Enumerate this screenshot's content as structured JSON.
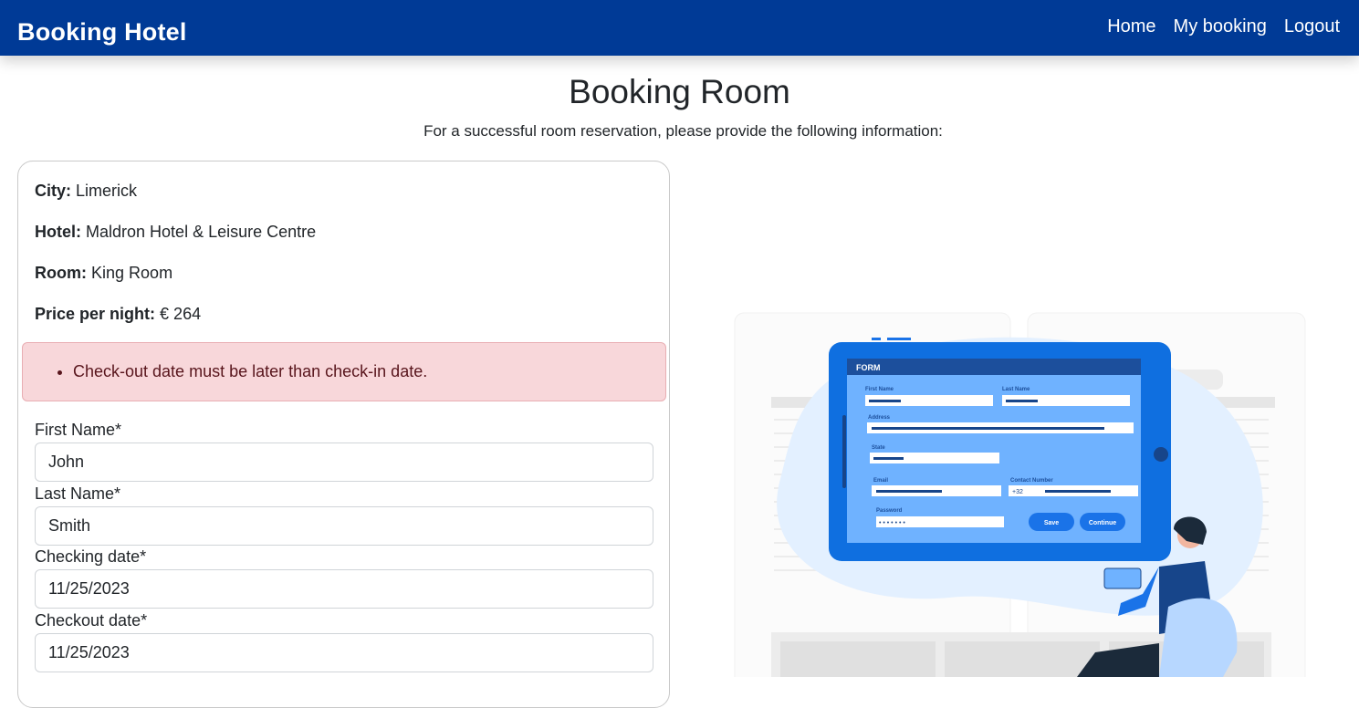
{
  "navbar": {
    "brand": "Booking Hotel",
    "links": [
      "Home",
      "My booking",
      "Logout"
    ],
    "color": "#003a96"
  },
  "page": {
    "title": "Booking Room",
    "subtitle": "For a successful room reservation, please provide the following information:"
  },
  "booking": {
    "city_label": "City:",
    "city": "Limerick",
    "hotel_label": "Hotel:",
    "hotel": "Maldron Hotel & Leisure Centre",
    "room_label": "Room:",
    "room": "King Room",
    "price_label": "Price per night:",
    "price": "€ 264"
  },
  "alert": {
    "errors": [
      "Check-out date must be later than check-in date."
    ]
  },
  "form": {
    "first_name": {
      "label": "First Name*",
      "value": "John"
    },
    "last_name": {
      "label": "Last Name*",
      "value": "Smith"
    },
    "checkin": {
      "label": "Checking date*",
      "value": "11/25/2023"
    },
    "checkout": {
      "label": "Checkout date*",
      "value": "11/25/2023"
    }
  },
  "illustration": {
    "header": "FORM",
    "first_name": "First Name",
    "last_name": "Last Name",
    "address": "Address",
    "state": "State",
    "email": "Email",
    "contact": "Contact Number",
    "country_code": "+32",
    "password": "Password",
    "password_mask": "• • • • • • •",
    "save": "Save",
    "continue": "Continue"
  }
}
